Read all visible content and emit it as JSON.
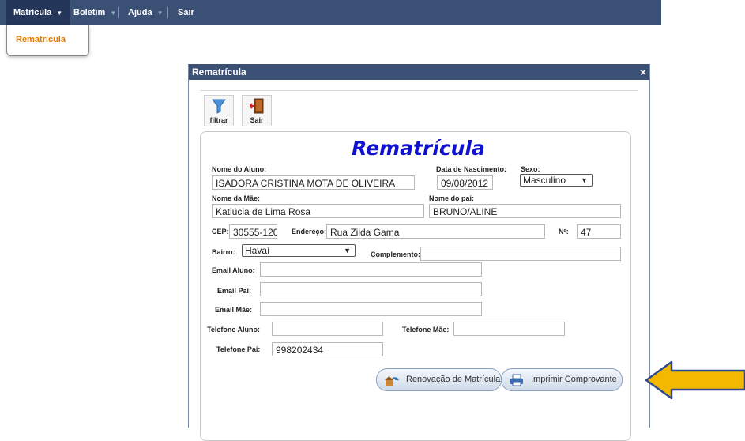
{
  "menu": {
    "items": [
      {
        "label": "Matrícula"
      },
      {
        "label": "Boletim"
      },
      {
        "label": "Ajuda"
      },
      {
        "label": "Sair"
      }
    ],
    "dropdown": {
      "items": [
        {
          "label": "Rematrícula"
        }
      ]
    }
  },
  "modal": {
    "title": "Rematrícula",
    "close": "×",
    "toolbar": {
      "filter_label": "filtrar",
      "exit_label": "Sair"
    }
  },
  "form": {
    "heading": "Rematrícula",
    "student_name": {
      "label": "Nome do Aluno:",
      "value": "ISADORA CRISTINA MOTA DE OLIVEIRA"
    },
    "birth_date": {
      "label": "Data de Nascimento:",
      "value": "09/08/2012"
    },
    "sex": {
      "label": "Sexo:",
      "value": "Masculino"
    },
    "mother_name": {
      "label": "Nome da Mãe:",
      "value": "Katiúcia de Lima Rosa"
    },
    "father_name": {
      "label": "Nome do pai:",
      "value": "BRUNO/ALINE"
    },
    "cep": {
      "label": "CEP:",
      "value": "30555-120"
    },
    "address": {
      "label": "Endereço:",
      "value": "Rua Zilda Gama"
    },
    "number": {
      "label": "Nº:",
      "value": "47"
    },
    "district": {
      "label": "Bairro:",
      "value": "Havaí"
    },
    "complement": {
      "label": "Complemento:",
      "value": ""
    },
    "email_student": {
      "label": "Email Aluno:",
      "value": ""
    },
    "email_father": {
      "label": "Email Pai:",
      "value": ""
    },
    "email_mother": {
      "label": "Email Mãe:",
      "value": ""
    },
    "phone_student": {
      "label": "Telefone Aluno:",
      "value": ""
    },
    "phone_mother": {
      "label": "Telefone Mãe:",
      "value": ""
    },
    "phone_father": {
      "label": "Telefone Pai:",
      "value": "998202434"
    },
    "renew_button": "Renovação de Matrícula",
    "print_button": "Imprimir Comprovante"
  },
  "colors": {
    "menubar": "#3b5075",
    "accent_orange": "#e07b00",
    "heading_blue": "#1010d0",
    "arrow": "#f5b800"
  }
}
